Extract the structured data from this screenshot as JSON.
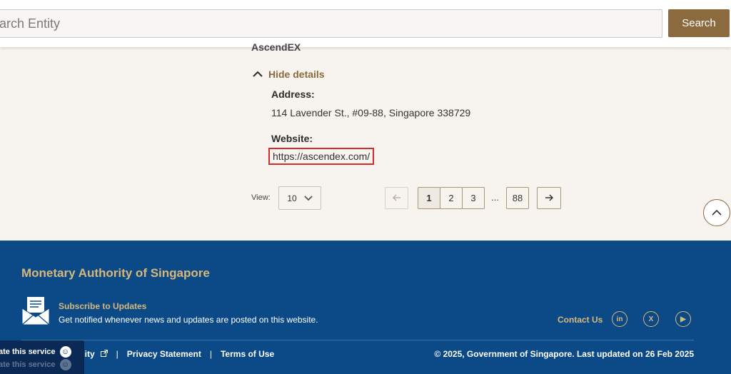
{
  "search": {
    "placeholder": "earch Entity",
    "button_label": "Search"
  },
  "entity": {
    "name_partial": "AscendEX"
  },
  "details": {
    "toggle_label": "Hide details",
    "address_label": "Address:",
    "address_value": "114 Lavender St., #09-88, Singapore 338729",
    "website_label": "Website:",
    "website_value": "https://ascendex.com/"
  },
  "pagination": {
    "view_label": "View:",
    "view_value": "10",
    "pages": [
      "1",
      "2",
      "3"
    ],
    "ellipsis": "...",
    "last_page": "88",
    "current": "1"
  },
  "footer": {
    "title": "Monetary Authority of Singapore",
    "subscribe_title": "Subscribe to Updates",
    "subscribe_desc": "Get notified whenever news and updates are posted on this website.",
    "contact_label": "Contact Us",
    "social": [
      "in",
      "X",
      "▶"
    ],
    "links": [
      "ility",
      "Privacy Statement",
      "Terms of Use"
    ],
    "copyright": "© 2025, Government of Singapore. Last updated on 26 Feb 2025"
  },
  "rate_widget": {
    "label": "ate this service"
  },
  "colors": {
    "accent": "#8b6b3d",
    "footer_bg": "#0c4a87",
    "gold": "#d8b87a",
    "highlight_border": "#d62a2a"
  }
}
